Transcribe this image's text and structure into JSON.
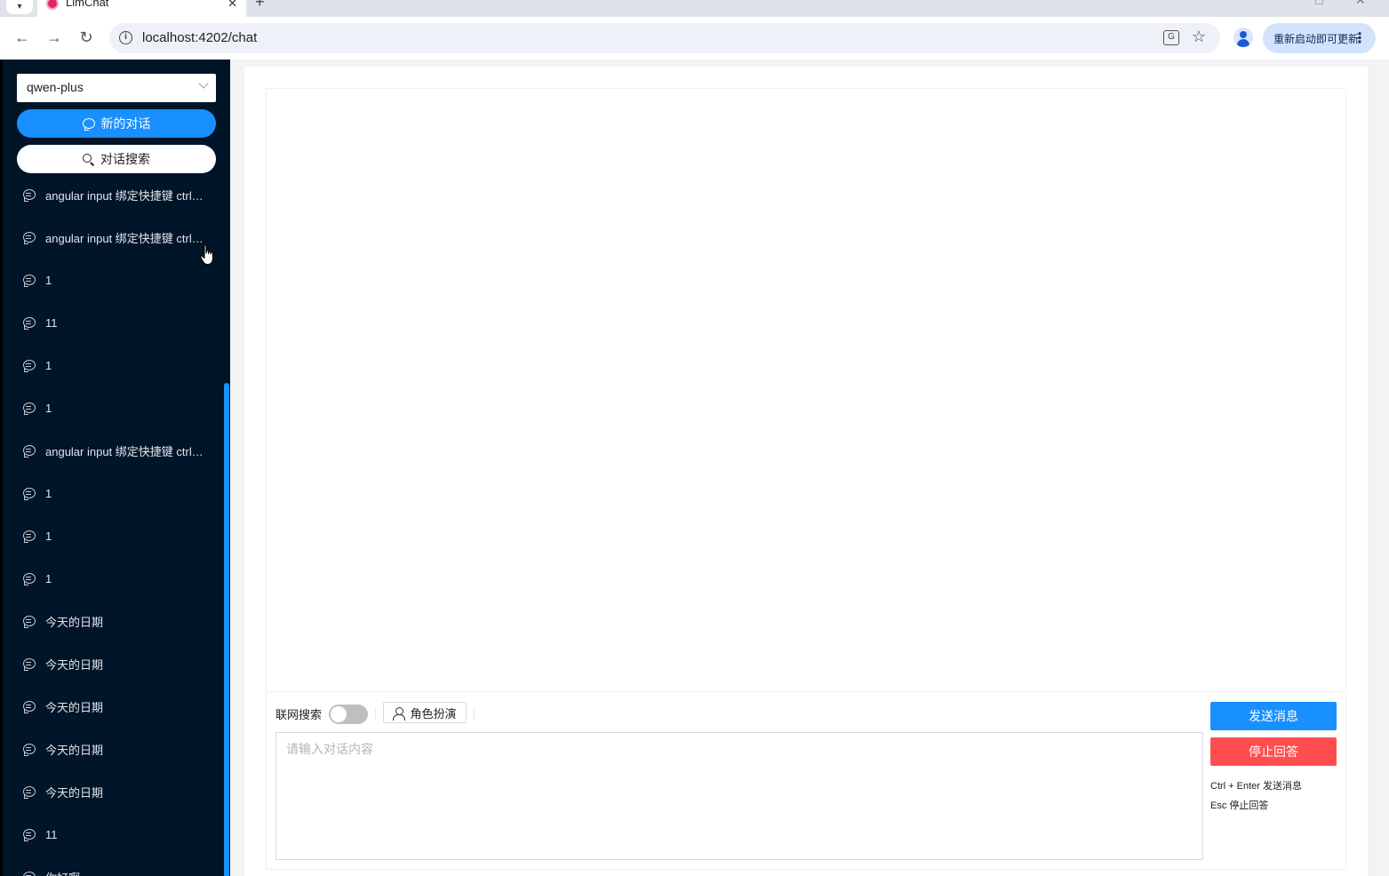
{
  "browser": {
    "tab_title": "LlmChat",
    "url": "localhost:4202/chat",
    "update_button": "重新启动即可更新"
  },
  "sidebar": {
    "model_select": "qwen-plus",
    "new_chat_label": "新的对话",
    "search_label": "对话搜索",
    "conversations": [
      "angular input 绑定快捷键 ctrl+enter",
      "angular input 绑定快捷键 ctrl+enter",
      "1",
      "11",
      "1",
      "1",
      "angular input 绑定快捷键 ctrl+enter",
      "1",
      "1",
      "1",
      "今天的日期",
      "今天的日期",
      "今天的日期",
      "今天的日期",
      "今天的日期",
      "11",
      "你好啊"
    ]
  },
  "compose": {
    "web_search_label": "联网搜索",
    "web_search_on": false,
    "role_play_label": "角色扮演",
    "input_placeholder": "请输入对话内容",
    "input_value": "",
    "send_label": "发送消息",
    "stop_label": "停止回答",
    "hint_send": "Ctrl + Enter 发送消息",
    "hint_stop": "Esc 停止回答"
  },
  "colors": {
    "sidebar_bg": "#011528",
    "primary": "#1890ff",
    "danger": "#ff4d4f"
  }
}
